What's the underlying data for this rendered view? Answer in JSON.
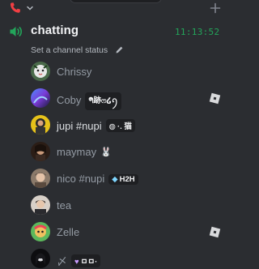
{
  "channel": {
    "name": "chatting",
    "timer": "11:13:52",
    "status_placeholder": "Set a channel status"
  },
  "members": [
    {
      "name": "Chrissy",
      "tag": "",
      "tag_glyph": "",
      "activity": false,
      "bright": false
    },
    {
      "name": "Coby",
      "tag": "ᖗ跡ෆ໒ꪆ",
      "tag_glyph": "",
      "activity": true,
      "bright": false
    },
    {
      "name": "jupi #nupi",
      "tag": "·. 猫",
      "tag_glyph": "◍",
      "activity": false,
      "bright": true
    },
    {
      "name": "maymay",
      "tag": "",
      "tag_glyph": "",
      "activity": false,
      "bright": false,
      "emoji": "🐰"
    },
    {
      "name": "nico #nupi",
      "tag": "H2H",
      "tag_glyph": "◆",
      "activity": false,
      "bright": false
    },
    {
      "name": "tea",
      "tag": "",
      "tag_glyph": "",
      "activity": false,
      "bright": false
    },
    {
      "name": "Zelle",
      "tag": "",
      "tag_glyph": "",
      "activity": true,
      "bright": false
    },
    {
      "name": "〆",
      "tag": "ㅁㅁ·",
      "tag_glyph": "♥",
      "activity": false,
      "bright": false
    }
  ],
  "colors": {
    "accent_green": "#23a55a",
    "phone_red": "#f23f43",
    "background": "#2b2d31"
  },
  "icons": {
    "phone": "phone-icon",
    "speaker": "speaker-icon",
    "pencil": "pencil-icon",
    "activity": "roblox-activity-icon",
    "plus": "plus-icon"
  }
}
